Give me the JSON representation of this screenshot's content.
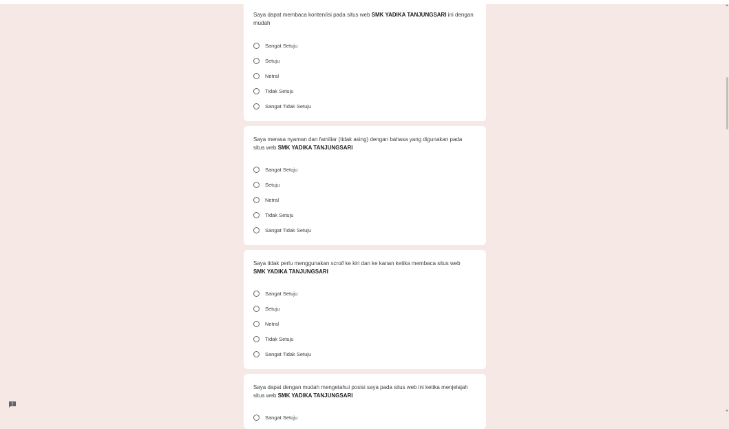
{
  "school_name": "SMK YADIKA TANJUNGSARI",
  "questions": [
    {
      "pre": "Saya dapat membaca konten/isi pada situs web ",
      "post": " ini dengan mudah"
    },
    {
      "pre": "Saya merasa nyaman dan familiar (tidak asing) dengan bahasa yang digunakan pada situs web ",
      "post": ""
    },
    {
      "pre": "Saya tidak perlu menggunakan ",
      "em": "scroll",
      "mid": " ke kiri dan ke kanan ketika membaca situs web ",
      "post": ""
    },
    {
      "pre": "Saya dapat dengan mudah mengetahui posisi saya pada situs web ini ketika menjelajah situs web ",
      "post": ""
    }
  ],
  "options": {
    "sangat_setuju": "Sangat Setuju",
    "setuju": "Setuju",
    "netral": "Netral",
    "tidak_setuju": "Tidak Setuju",
    "sangat_tidak_setuju": "Sangat Tidak Setuju"
  },
  "icons": {
    "feedback": "feedback-icon"
  },
  "colors": {
    "page_background": "#f6e9e5",
    "card_background": "#ffffff",
    "text": "#3c4043",
    "radio_border": "#5f6368"
  }
}
